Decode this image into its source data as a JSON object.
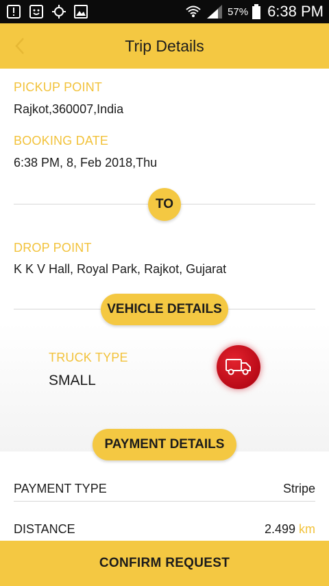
{
  "status_bar": {
    "battery_percent": "57%",
    "time": "6:38 PM",
    "icons": [
      "notification-icon",
      "message-icon",
      "gps-icon",
      "image-icon",
      "wifi-icon",
      "signal-icon",
      "battery-icon"
    ]
  },
  "header": {
    "title": "Trip Details",
    "back_icon": "chevron-left-icon"
  },
  "pickup": {
    "label": "PICKUP POINT",
    "value": "Rajkot,360007,India"
  },
  "booking": {
    "label": "BOOKING DATE",
    "value": "6:38 PM, 8, Feb 2018,Thu"
  },
  "to_badge": "TO",
  "drop": {
    "label": "DROP POINT",
    "value": "K K V Hall, Royal Park, Rajkot, Gujarat"
  },
  "vehicle": {
    "section_title": "VEHICLE DETAILS",
    "truck_type_label": "TRUCK TYPE",
    "truck_type_value": "SMALL",
    "icon": "truck-icon"
  },
  "payment": {
    "section_title": "PAYMENT DETAILS",
    "rows": [
      {
        "label": "PAYMENT TYPE",
        "value": "Stripe",
        "unit": ""
      },
      {
        "label": "DISTANCE",
        "value": "2.499",
        "unit": "km"
      }
    ]
  },
  "confirm_button": "CONFIRM REQUEST",
  "colors": {
    "accent": "#f4c842",
    "label": "#f2c23a",
    "truck_badge": "#d0101c",
    "status_bar": "#0b0b0b"
  }
}
